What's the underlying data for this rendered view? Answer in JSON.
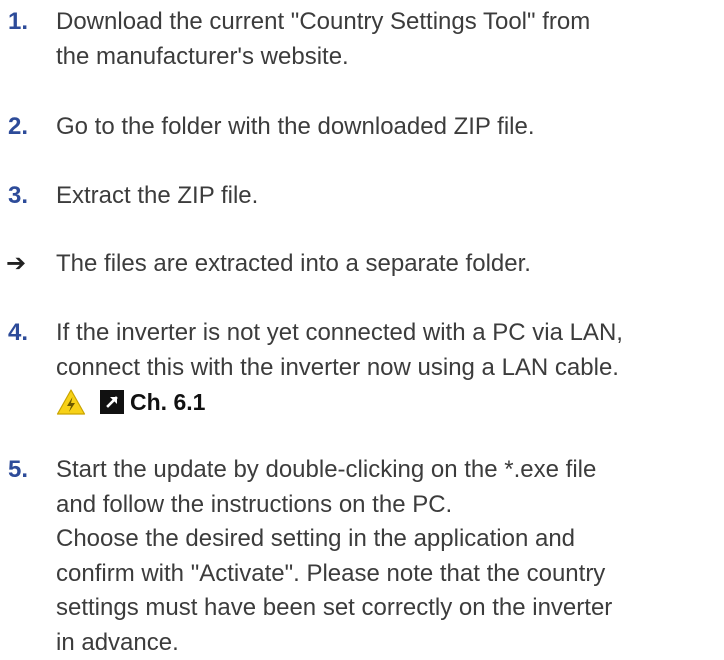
{
  "steps": [
    {
      "number": "1.",
      "lines": [
        "Download the current \"Country Settings Tool\" from",
        "the manufacturer's website."
      ]
    },
    {
      "number": "2.",
      "lines": [
        "Go to the folder with the downloaded ZIP file."
      ]
    },
    {
      "number": "3.",
      "lines": [
        "Extract the ZIP file."
      ]
    },
    {
      "arrow": "➔",
      "lines": [
        "The files are extracted into a separate folder."
      ]
    },
    {
      "number": "4.",
      "lines": [
        "If the inverter is not yet connected with a PC via LAN,",
        "connect this with the inverter now using a LAN cable."
      ],
      "reference": "Ch. 6.1",
      "warning_icon": "high-voltage-warning-icon",
      "link_icon": "cross-reference-arrow-icon"
    },
    {
      "number": "5.",
      "lines": [
        "Start the update by double-clicking on the *.exe file",
        "and follow the instructions on the PC.",
        "Choose the desired setting in the application and",
        "confirm with \"Activate\". Please note that the country",
        "settings must have been set correctly on the inverter",
        "in advance."
      ]
    }
  ],
  "colors": {
    "step_number": "#2d4b99",
    "body_text": "#3c3c3c",
    "warning_yellow": "#f7d117"
  }
}
